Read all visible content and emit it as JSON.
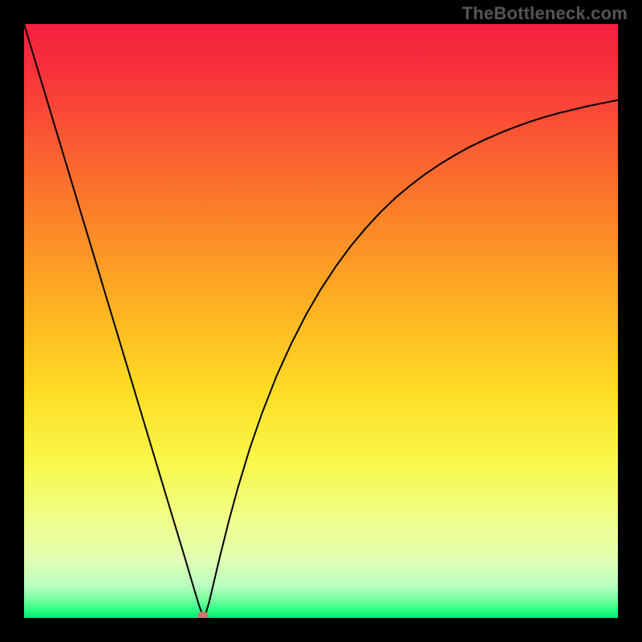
{
  "watermark": "TheBottleneck.com",
  "chart_data": {
    "type": "line",
    "title": "",
    "xlabel": "",
    "ylabel": "",
    "xlim": [
      0,
      100
    ],
    "ylim": [
      0,
      100
    ],
    "background_gradient": {
      "stops": [
        {
          "offset": 0.0,
          "color": "#f5223e"
        },
        {
          "offset": 0.06,
          "color": "#f72c3c"
        },
        {
          "offset": 0.18,
          "color": "#fa5433"
        },
        {
          "offset": 0.32,
          "color": "#fb8129"
        },
        {
          "offset": 0.48,
          "color": "#fdb321"
        },
        {
          "offset": 0.62,
          "color": "#fedd24"
        },
        {
          "offset": 0.74,
          "color": "#f9f84b"
        },
        {
          "offset": 0.84,
          "color": "#eeff8d"
        },
        {
          "offset": 0.9,
          "color": "#e2ffb3"
        },
        {
          "offset": 0.945,
          "color": "#baffbe"
        },
        {
          "offset": 0.97,
          "color": "#74ff9f"
        },
        {
          "offset": 0.987,
          "color": "#2bfd87"
        },
        {
          "offset": 1.0,
          "color": "#06e96e"
        }
      ]
    },
    "series": [
      {
        "name": "bottleneck-curve",
        "color": "#000000",
        "stroke_width": 2.0,
        "x": [
          0.0,
          2.5,
          5.0,
          7.5,
          10.0,
          12.5,
          15.0,
          17.5,
          20.0,
          22.5,
          25.0,
          27.0,
          28.5,
          29.5,
          30.1,
          30.6,
          31.2,
          32.0,
          33.0,
          34.5,
          36.0,
          38.0,
          40.0,
          42.5,
          45.0,
          47.5,
          50.0,
          52.5,
          55.0,
          57.5,
          60.0,
          62.5,
          65.0,
          67.5,
          70.0,
          72.5,
          75.0,
          77.5,
          80.0,
          82.5,
          85.0,
          87.5,
          90.0,
          92.5,
          95.0,
          97.5,
          100.0
        ],
        "y": [
          100.0,
          91.7,
          83.4,
          75.1,
          66.8,
          58.5,
          50.2,
          41.9,
          33.6,
          25.3,
          17.0,
          10.4,
          5.3,
          2.0,
          0.4,
          0.8,
          2.8,
          6.2,
          10.4,
          16.4,
          21.9,
          28.5,
          34.3,
          40.7,
          46.2,
          51.1,
          55.4,
          59.2,
          62.6,
          65.6,
          68.3,
          70.7,
          72.8,
          74.7,
          76.4,
          77.9,
          79.3,
          80.5,
          81.6,
          82.6,
          83.5,
          84.3,
          85.0,
          85.6,
          86.2,
          86.7,
          87.2
        ]
      }
    ],
    "marker": {
      "name": "optimal-point",
      "x": 30.1,
      "y": 0.4,
      "color": "#c97a6e",
      "rx": 7,
      "ry": 5
    }
  }
}
